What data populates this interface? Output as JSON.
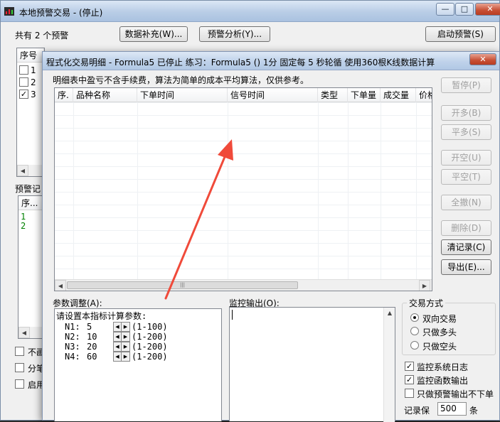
{
  "back_window": {
    "title": "本地预警交易 - (停止)",
    "alert_count_text": "共有 2 个预警",
    "buttons": {
      "data_fill": "数据补充(W)...",
      "alert_analysis": "预警分析(Y)...",
      "start_alert": "启动预警(S)"
    },
    "list_header": "序号",
    "list_rows": [
      {
        "checked": false,
        "num": "1"
      },
      {
        "checked": false,
        "num": "2"
      },
      {
        "checked": true,
        "num": "3"
      }
    ],
    "record_label": "预警记",
    "record_header": "序...",
    "record_rows": [
      "1",
      "2"
    ],
    "bottom_options": [
      "不画",
      "分笔",
      "启用"
    ]
  },
  "front_window": {
    "title": "程式化交易明细 - Formula5 已停止  练习：Formula5 () 1分 固定每 5 秒轮循 使用360根K线数据计算",
    "notice": "明细表中盈亏不含手续费，算法为简单的成本平均算法，仅供参考。",
    "table_columns": [
      "序.",
      "品种名称",
      "下单时间",
      "信号时间",
      "类型",
      "下单量",
      "成交量",
      "价格"
    ],
    "side_buttons": {
      "pause": "暂停(P)",
      "open_long": "开多(B)",
      "close_long": "平多(S)",
      "open_short": "开空(U)",
      "close_short": "平空(T)",
      "cancel_all": "全撤(N)",
      "delete": "删除(D)",
      "clear_records": "清记录(C)",
      "export": "导出(E)..."
    },
    "params": {
      "label": "参数调整(A):",
      "prompt": "请设置本指标计算参数:",
      "rows": [
        {
          "name": "N1:",
          "value": "5",
          "range": "(1-100)"
        },
        {
          "name": "N2:",
          "value": "10",
          "range": "(1-200)"
        },
        {
          "name": "N3:",
          "value": "20",
          "range": "(1-200)"
        },
        {
          "name": "N4:",
          "value": "60",
          "range": "(1-200)"
        }
      ]
    },
    "monitor_label": "监控输出(O):",
    "trade_mode": {
      "label": "交易方式",
      "options": [
        {
          "label": "双向交易",
          "selected": true
        },
        {
          "label": "只做多头",
          "selected": false
        },
        {
          "label": "只做空头",
          "selected": false
        }
      ]
    },
    "checks": [
      {
        "label": "监控系统日志",
        "checked": true
      },
      {
        "label": "监控函数输出",
        "checked": true
      },
      {
        "label": "只做预警输出不下单",
        "checked": false
      }
    ],
    "record_keep": {
      "label": "记录保",
      "value": "500",
      "unit": "条"
    }
  },
  "colors": {
    "green_text": "#008000",
    "arrow": "#f04a3a",
    "titlebar": "#bfd2ea"
  }
}
